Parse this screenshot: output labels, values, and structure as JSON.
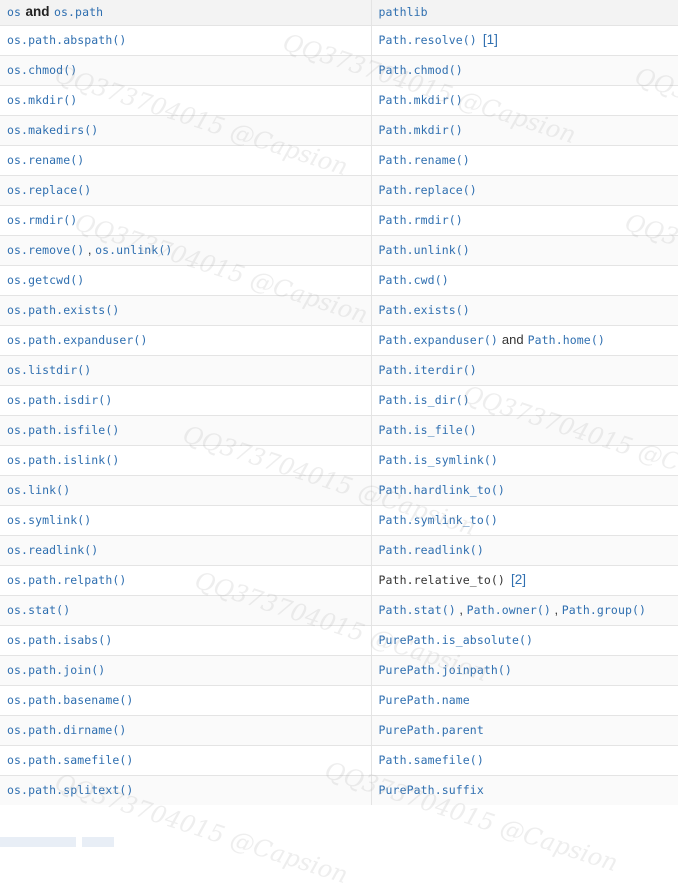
{
  "table": {
    "header": {
      "left": [
        "os",
        "and",
        "os.path"
      ],
      "right": "pathlib"
    },
    "rows": [
      {
        "left": [
          "os.path.abspath()"
        ],
        "right": [
          "Path.resolve()"
        ],
        "ref": "[1]"
      },
      {
        "left": [
          "os.chmod()"
        ],
        "right": [
          "Path.chmod()"
        ]
      },
      {
        "left": [
          "os.mkdir()"
        ],
        "right": [
          "Path.mkdir()"
        ]
      },
      {
        "left": [
          "os.makedirs()"
        ],
        "right": [
          "Path.mkdir()"
        ]
      },
      {
        "left": [
          "os.rename()"
        ],
        "right": [
          "Path.rename()"
        ]
      },
      {
        "left": [
          "os.replace()"
        ],
        "right": [
          "Path.replace()"
        ]
      },
      {
        "left": [
          "os.rmdir()"
        ],
        "right": [
          "Path.rmdir()"
        ]
      },
      {
        "left": [
          "os.remove()",
          "os.unlink()"
        ],
        "right": [
          "Path.unlink()"
        ]
      },
      {
        "left": [
          "os.getcwd()"
        ],
        "right": [
          "Path.cwd()"
        ]
      },
      {
        "left": [
          "os.path.exists()"
        ],
        "right": [
          "Path.exists()"
        ]
      },
      {
        "left": [
          "os.path.expanduser()"
        ],
        "right": [
          "Path.expanduser()",
          "Path.home()"
        ],
        "rightSep": "and"
      },
      {
        "left": [
          "os.listdir()"
        ],
        "right": [
          "Path.iterdir()"
        ]
      },
      {
        "left": [
          "os.path.isdir()"
        ],
        "right": [
          "Path.is_dir()"
        ]
      },
      {
        "left": [
          "os.path.isfile()"
        ],
        "right": [
          "Path.is_file()"
        ]
      },
      {
        "left": [
          "os.path.islink()"
        ],
        "right": [
          "Path.is_symlink()"
        ]
      },
      {
        "left": [
          "os.link()"
        ],
        "right": [
          "Path.hardlink_to()"
        ]
      },
      {
        "left": [
          "os.symlink()"
        ],
        "right": [
          "Path.symlink_to()"
        ]
      },
      {
        "left": [
          "os.readlink()"
        ],
        "right": [
          "Path.readlink()"
        ]
      },
      {
        "left": [
          "os.path.relpath()"
        ],
        "right": [
          "Path.relative_to()"
        ],
        "ref": "[2]",
        "rightDark": true
      },
      {
        "left": [
          "os.stat()"
        ],
        "right": [
          "Path.stat()",
          "Path.owner()",
          "Path.group()"
        ]
      },
      {
        "left": [
          "os.path.isabs()"
        ],
        "right": [
          "PurePath.is_absolute()"
        ]
      },
      {
        "left": [
          "os.path.join()"
        ],
        "right": [
          "PurePath.joinpath()"
        ]
      },
      {
        "left": [
          "os.path.basename()"
        ],
        "right": [
          "PurePath.name"
        ]
      },
      {
        "left": [
          "os.path.dirname()"
        ],
        "right": [
          "PurePath.parent"
        ]
      },
      {
        "left": [
          "os.path.samefile()"
        ],
        "right": [
          "Path.samefile()"
        ]
      },
      {
        "left": [
          "os.path.splitext()"
        ],
        "right": [
          "PurePath.suffix"
        ]
      }
    ]
  },
  "watermark": {
    "text": "QQ373704015 @Capsion"
  },
  "colors": {
    "code": "#2f6fb0",
    "text": "#333333",
    "border": "#e4e4e4",
    "header_bg": "#f3f3f3"
  }
}
